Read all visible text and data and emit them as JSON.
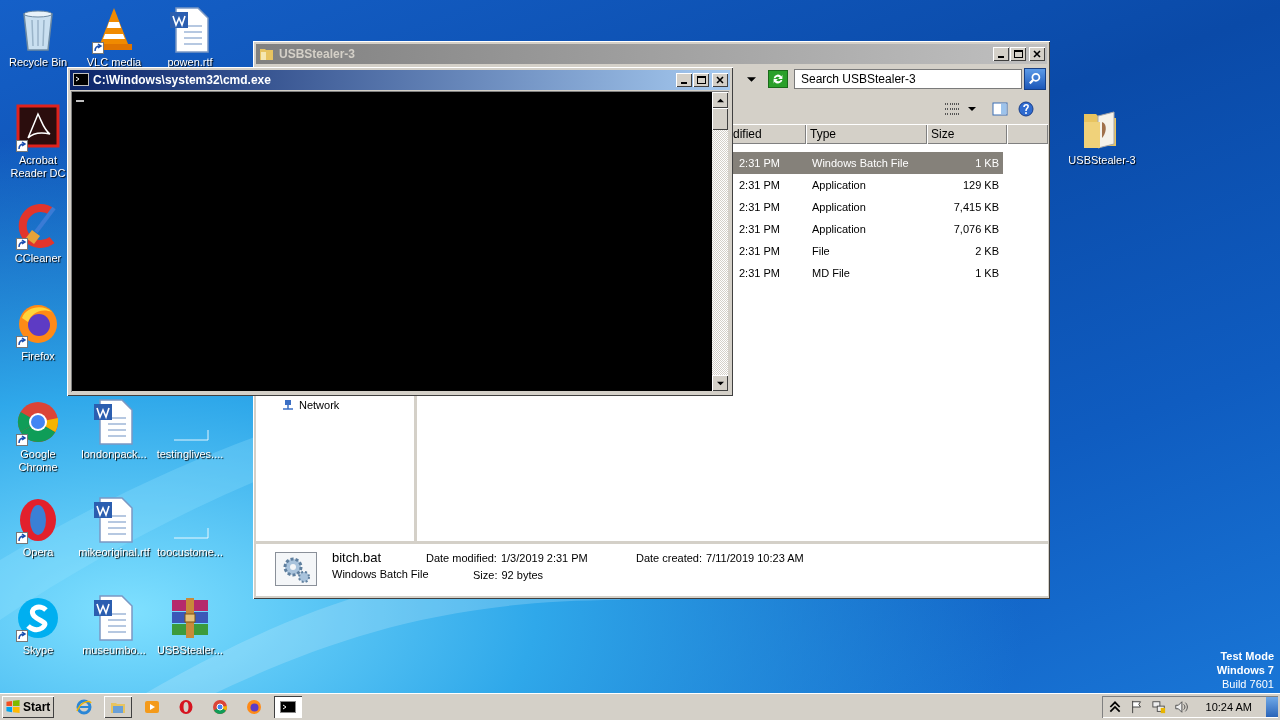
{
  "desktop": {
    "icons": [
      {
        "label": "Recycle Bin",
        "kind": "recycle",
        "shortcut": false
      },
      {
        "label": "Acrobat Reader DC",
        "kind": "acrobat",
        "shortcut": true
      },
      {
        "label": "CCleaner",
        "kind": "ccleaner",
        "shortcut": true
      },
      {
        "label": "Firefox",
        "kind": "firefox",
        "shortcut": true
      },
      {
        "label": "Google Chrome",
        "kind": "chrome",
        "shortcut": true
      },
      {
        "label": "Opera",
        "kind": "opera",
        "shortcut": true
      },
      {
        "label": "Skype",
        "kind": "skype",
        "shortcut": true
      },
      {
        "label": "VLC media",
        "kind": "vlc",
        "shortcut": true
      },
      {
        "label": "londonpack...",
        "kind": "word",
        "shortcut": false
      },
      {
        "label": "mikeoriginal.rtf",
        "kind": "word",
        "shortcut": false
      },
      {
        "label": "museumbo...",
        "kind": "word",
        "shortcut": false
      },
      {
        "label": "powen.rtf",
        "kind": "word",
        "shortcut": false
      },
      {
        "label": "testinglives....",
        "kind": "blank",
        "shortcut": false
      },
      {
        "label": "toocustome...",
        "kind": "blank",
        "shortcut": false
      },
      {
        "label": "USBStealer...",
        "kind": "winrar",
        "shortcut": false
      },
      {
        "label": "USBStealer-3",
        "kind": "folder",
        "shortcut": false
      }
    ],
    "watermark": [
      "Test Mode",
      "Windows 7",
      "Build 7601"
    ]
  },
  "explorer": {
    "title": "USBStealer-3",
    "active": false,
    "search": {
      "placeholder": "Search USBStealer-3"
    },
    "columns": [
      "dified",
      "Type",
      "Size"
    ],
    "rows": [
      {
        "modified": "2:31 PM",
        "type": "Windows Batch File",
        "size": "1 KB",
        "selected": true
      },
      {
        "modified": "2:31 PM",
        "type": "Application",
        "size": "129 KB",
        "selected": false
      },
      {
        "modified": "2:31 PM",
        "type": "Application",
        "size": "7,415 KB",
        "selected": false
      },
      {
        "modified": "2:31 PM",
        "type": "Application",
        "size": "7,076 KB",
        "selected": false
      },
      {
        "modified": "2:31 PM",
        "type": "File",
        "size": "2 KB",
        "selected": false
      },
      {
        "modified": "2:31 PM",
        "type": "MD File",
        "size": "1 KB",
        "selected": false
      }
    ],
    "nav_items": [
      "Network"
    ],
    "details": {
      "name": "bitch.bat",
      "type": "Windows Batch File",
      "fields": [
        {
          "label": "Date modified:",
          "value": "1/3/2019 2:31 PM"
        },
        {
          "label": "Size:",
          "value": "92 bytes"
        },
        {
          "label": "Date created:",
          "value": "7/11/2019 10:23 AM"
        }
      ]
    }
  },
  "console": {
    "title": "C:\\Windows\\system32\\cmd.exe",
    "active": true
  },
  "taskbar": {
    "start": "Start",
    "apps": [
      {
        "kind": "ie",
        "open": false,
        "selected": false
      },
      {
        "kind": "explorer",
        "open": true,
        "selected": false
      },
      {
        "kind": "media",
        "open": false,
        "selected": false
      },
      {
        "kind": "opera",
        "open": false,
        "selected": false
      },
      {
        "kind": "chrome",
        "open": false,
        "selected": false
      },
      {
        "kind": "firefox",
        "open": false,
        "selected": false
      },
      {
        "kind": "cmd",
        "open": true,
        "selected": true
      }
    ],
    "clock": "10:24 AM"
  }
}
